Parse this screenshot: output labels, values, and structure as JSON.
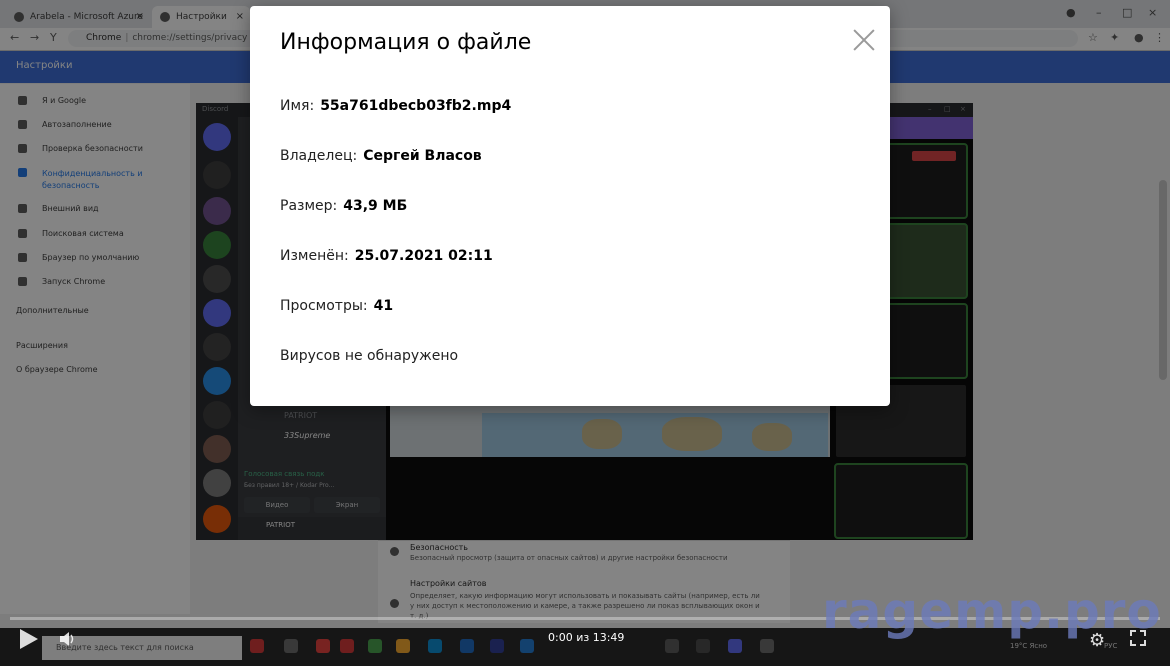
{
  "browser": {
    "tabs": [
      {
        "label": "Arabela - Microsoft Azure"
      },
      {
        "label": "Настройки"
      }
    ],
    "address_scheme": "Chrome",
    "address_url": "chrome://settings/privacy"
  },
  "settings": {
    "header_title": "Настройки",
    "sidebar_items": [
      {
        "label": "Я и Google"
      },
      {
        "label": "Автозаполнение"
      },
      {
        "label": "Проверка безопасности"
      },
      {
        "label": "Конфиденциальность и безопасность"
      },
      {
        "label": "Внешний вид"
      },
      {
        "label": "Поисковая система"
      },
      {
        "label": "Браузер по умолчанию"
      },
      {
        "label": "Запуск Chrome"
      }
    ],
    "advanced_label": "Дополнительные",
    "extensions_label": "Расширения",
    "about_label": "О браузере Chrome",
    "content_rows": [
      {
        "title": "Безопасность",
        "desc": "Безопасный просмотр (защита от опасных сайтов) и другие настройки безопасности"
      },
      {
        "title": "Настройки сайтов",
        "desc": "Определяет, какую информацию могут использовать и показывать сайты (например, есть ли у них доступ к местоположению и камере, а также разрешено ли показ всплывающих окон и т. д.)"
      }
    ]
  },
  "discord": {
    "app_name": "Discord",
    "channel_user_1": "PATRIOT",
    "channel_user_2": "33Supreme",
    "voice_status": "Голосовая связь подк",
    "voice_detail": "Без правил 18+ / Kodar Pro...",
    "video_button": "Видео",
    "screen_button": "Экран",
    "bottom_user": "PATRIOT"
  },
  "modal": {
    "title": "Информация о файле",
    "name_label": "Имя:",
    "name_value": "55a761dbecb03fb2.mp4",
    "owner_label": "Владелец:",
    "owner_value": "Сергей Власов",
    "size_label": "Размер:",
    "size_value": "43,9 МБ",
    "modified_label": "Изменён:",
    "modified_value": "25.07.2021 02:11",
    "views_label": "Просмотры:",
    "views_value": "41",
    "virus_status": "Вирусов не обнаружено"
  },
  "player": {
    "timecode": "0:00 из 13:49",
    "watermark": "ragemp.pro"
  },
  "taskbar": {
    "search_placeholder": "Введите здесь текст для поиска",
    "weather": "19°C Ясно",
    "lang": "РУС"
  }
}
